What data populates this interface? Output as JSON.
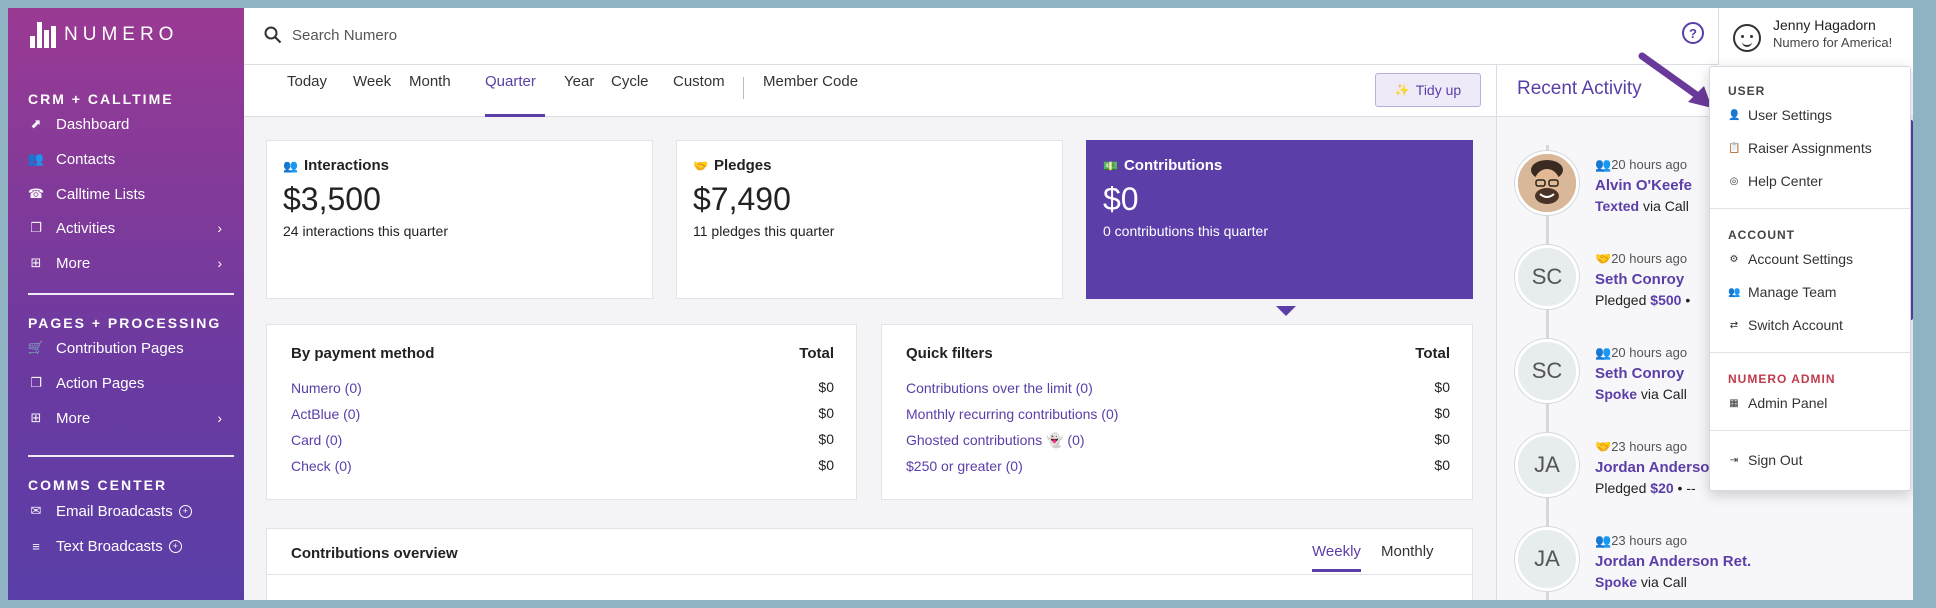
{
  "brand": {
    "name": "NUMERO"
  },
  "sidebar": {
    "section1": "CRM + CALLTIME",
    "section1_items": [
      {
        "label": "Dashboard",
        "icon": "dashboard-icon"
      },
      {
        "label": "Contacts",
        "icon": "contacts-icon"
      },
      {
        "label": "Calltime Lists",
        "icon": "phone-icon"
      },
      {
        "label": "Activities",
        "icon": "activities-icon"
      },
      {
        "label": "More",
        "icon": "more-icon"
      }
    ],
    "section2": "PAGES + PROCESSING",
    "section2_items": [
      {
        "label": "Contribution Pages",
        "icon": "cart-icon"
      },
      {
        "label": "Action Pages",
        "icon": "page-icon"
      },
      {
        "label": "More",
        "icon": "more-icon"
      }
    ],
    "section3": "COMMS CENTER",
    "section3_items": [
      {
        "label": "Email Broadcasts",
        "icon": "email-icon"
      },
      {
        "label": "Text Broadcasts",
        "icon": "text-icon"
      }
    ]
  },
  "topbar": {
    "search_placeholder": "Search Numero",
    "help": "?",
    "user_name": "Jenny Hagadorn",
    "user_org": "Numero for America!"
  },
  "tabs": [
    "Today",
    "Week",
    "Month",
    "Quarter",
    "Year",
    "Cycle",
    "Custom",
    "Member Code"
  ],
  "active_tab": "Quarter",
  "tidy_label": "Tidy up",
  "stats": [
    {
      "title": "Interactions",
      "value": "$3,500",
      "sub": "24 interactions this quarter"
    },
    {
      "title": "Pledges",
      "value": "$7,490",
      "sub": "11 pledges this quarter"
    },
    {
      "title": "Contributions",
      "value": "$0",
      "sub": "0 contributions this quarter"
    }
  ],
  "payment": {
    "title": "By payment method",
    "total_label": "Total",
    "rows": [
      {
        "label": "Numero (0)",
        "amount": "$0"
      },
      {
        "label": "ActBlue (0)",
        "amount": "$0"
      },
      {
        "label": "Card (0)",
        "amount": "$0"
      },
      {
        "label": "Check (0)",
        "amount": "$0"
      }
    ]
  },
  "filters": {
    "title": "Quick filters",
    "total_label": "Total",
    "rows": [
      {
        "label": "Contributions over the limit (0)",
        "amount": "$0"
      },
      {
        "label": "Monthly recurring contributions (0)",
        "amount": "$0"
      },
      {
        "label": "Ghosted contributions 👻 (0)",
        "amount": "$0"
      },
      {
        "label": "$250 or greater (0)",
        "amount": "$0"
      }
    ]
  },
  "overview": {
    "title": "Contributions overview",
    "tab_weekly": "Weekly",
    "tab_monthly": "Monthly"
  },
  "activity": {
    "title": "Recent Activity",
    "items": [
      {
        "initials": "",
        "time": "20 hours ago",
        "name": "Alvin O'Keefe",
        "action": "Texted",
        "rest": " via Call"
      },
      {
        "initials": "SC",
        "time": "20 hours ago",
        "name": "Seth Conroy",
        "action": "Pledged ",
        "value": "$500",
        "rest": " •"
      },
      {
        "initials": "SC",
        "time": "20 hours ago",
        "name": "Seth Conroy",
        "action": "Spoke",
        "rest": " via Call"
      },
      {
        "initials": "JA",
        "time": "23 hours ago",
        "name": "Jordan Anderson",
        "action": "Pledged ",
        "value": "$20",
        "rest": " • --"
      },
      {
        "initials": "JA",
        "time": "23 hours ago",
        "name": "Jordan Anderson Ret.",
        "action": "Spoke",
        "rest": " via Call"
      }
    ]
  },
  "menu": {
    "user_section": "USER",
    "user_items": [
      "User Settings",
      "Raiser Assignments",
      "Help Center"
    ],
    "account_section": "ACCOUNT",
    "account_items": [
      "Account Settings",
      "Manage Team",
      "Switch Account"
    ],
    "admin_section": "NUMERO ADMIN",
    "admin_items": [
      "Admin Panel"
    ],
    "sign_out": "Sign Out"
  },
  "colors": {
    "accent": "#5b3ea8",
    "admin": "#c03a4e"
  }
}
